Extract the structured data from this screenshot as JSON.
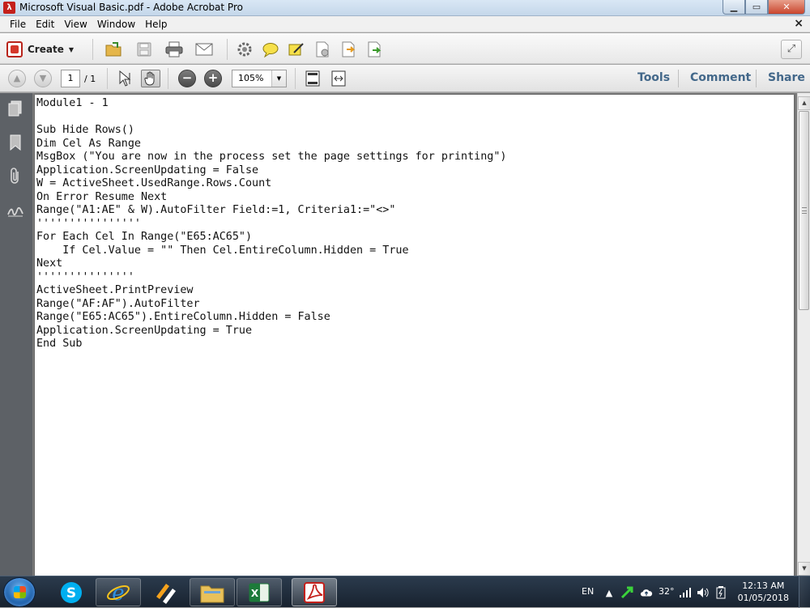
{
  "window": {
    "title": "Microsoft Visual Basic.pdf - Adobe Acrobat Pro",
    "minimize": "▁",
    "maximize": "▭",
    "close": "✕"
  },
  "menu": {
    "items": [
      "File",
      "Edit",
      "View",
      "Window",
      "Help"
    ],
    "close": "×"
  },
  "toolbar": {
    "create_label": "Create",
    "icons": [
      "open-icon",
      "save-icon",
      "print-icon",
      "email-icon",
      "gear-icon",
      "comment-icon",
      "sign-icon",
      "review-icon",
      "export-icon",
      "share-doc-icon"
    ]
  },
  "nav": {
    "page_current": "1",
    "page_total": "/ 1",
    "zoom": "105%",
    "tabs": [
      "Tools",
      "Comment",
      "Share"
    ]
  },
  "document": {
    "lines": [
      "Module1 - 1",
      "",
      "Sub Hide Rows()",
      "Dim Cel As Range",
      "MsgBox (\"You are now in the process set the page settings for printing\")",
      "Application.ScreenUpdating = False",
      "W = ActiveSheet.UsedRange.Rows.Count",
      "On Error Resume Next",
      "Range(\"A1:AE\" & W).AutoFilter Field:=1, Criteria1:=\"<>\"",
      "''''''''''''''''",
      "For Each Cel In Range(\"E65:AC65\")",
      "    If Cel.Value = \"\" Then Cel.EntireColumn.Hidden = True",
      "Next",
      "'''''''''''''''",
      "ActiveSheet.PrintPreview",
      "Range(\"AF:AF\").AutoFilter",
      "Range(\"E65:AC65\").EntireColumn.Hidden = False",
      "Application.ScreenUpdating = True",
      "End Sub"
    ]
  },
  "taskbar": {
    "language": "EN",
    "temperature": "32",
    "time": "12:13 AM",
    "date": "01/05/2018"
  },
  "colors": {
    "acrobat_red": "#c4201b",
    "tab_blue": "#43688a",
    "panel_gray": "#5d6166"
  }
}
